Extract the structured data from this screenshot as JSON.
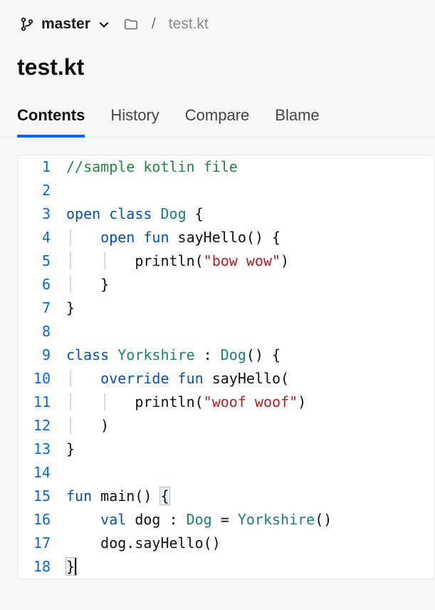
{
  "branch": "master",
  "breadcrumb": {
    "separator": "/",
    "file": "test.kt"
  },
  "title": "test.kt",
  "tabs": [
    "Contents",
    "History",
    "Compare",
    "Blame"
  ],
  "active_tab": 0,
  "code": {
    "lines": [
      {
        "n": 1,
        "tokens": [
          {
            "c": "c",
            "t": "//sample kotlin file"
          }
        ]
      },
      {
        "n": 2,
        "tokens": []
      },
      {
        "n": 3,
        "tokens": [
          {
            "c": "k",
            "t": "open"
          },
          {
            "t": " "
          },
          {
            "c": "k",
            "t": "class"
          },
          {
            "t": " "
          },
          {
            "c": "t",
            "t": "Dog"
          },
          {
            "t": " {"
          }
        ]
      },
      {
        "n": 4,
        "tokens": [
          {
            "c": "g",
            "t": "│   "
          },
          {
            "c": "k",
            "t": "open"
          },
          {
            "t": " "
          },
          {
            "c": "k",
            "t": "fun"
          },
          {
            "t": " sayHello() {"
          }
        ]
      },
      {
        "n": 5,
        "tokens": [
          {
            "c": "g",
            "t": "│   │   "
          },
          {
            "t": "println("
          },
          {
            "c": "s",
            "t": "\"bow wow\""
          },
          {
            "t": ")"
          }
        ]
      },
      {
        "n": 6,
        "tokens": [
          {
            "c": "g",
            "t": "│   "
          },
          {
            "t": "}"
          }
        ]
      },
      {
        "n": 7,
        "tokens": [
          {
            "t": "}"
          }
        ]
      },
      {
        "n": 8,
        "tokens": []
      },
      {
        "n": 9,
        "tokens": [
          {
            "c": "k",
            "t": "class"
          },
          {
            "t": " "
          },
          {
            "c": "t",
            "t": "Yorkshire"
          },
          {
            "t": " : "
          },
          {
            "c": "t",
            "t": "Dog"
          },
          {
            "t": "() {"
          }
        ]
      },
      {
        "n": 10,
        "tokens": [
          {
            "c": "g",
            "t": "│   "
          },
          {
            "c": "k",
            "t": "override"
          },
          {
            "t": " "
          },
          {
            "c": "k",
            "t": "fun"
          },
          {
            "t": " sayHello("
          }
        ]
      },
      {
        "n": 11,
        "tokens": [
          {
            "c": "g",
            "t": "│   │   "
          },
          {
            "t": "println("
          },
          {
            "c": "s",
            "t": "\"woof woof\""
          },
          {
            "t": ")"
          }
        ]
      },
      {
        "n": 12,
        "tokens": [
          {
            "c": "g",
            "t": "│   "
          },
          {
            "t": ")"
          }
        ]
      },
      {
        "n": 13,
        "tokens": [
          {
            "t": "}"
          }
        ]
      },
      {
        "n": 14,
        "tokens": []
      },
      {
        "n": 15,
        "tokens": [
          {
            "c": "k",
            "t": "fun"
          },
          {
            "t": " main() "
          },
          {
            "box": true,
            "t": "{"
          }
        ]
      },
      {
        "n": 16,
        "tokens": [
          {
            "t": "    "
          },
          {
            "c": "k",
            "t": "val"
          },
          {
            "t": " dog : "
          },
          {
            "c": "t",
            "t": "Dog"
          },
          {
            "t": " = "
          },
          {
            "c": "t",
            "t": "Yorkshire"
          },
          {
            "t": "()"
          }
        ]
      },
      {
        "n": 17,
        "tokens": [
          {
            "t": "    dog.sayHello()"
          }
        ]
      },
      {
        "n": 18,
        "tokens": [
          {
            "box": true,
            "cursor": true,
            "t": "}"
          }
        ]
      }
    ]
  }
}
